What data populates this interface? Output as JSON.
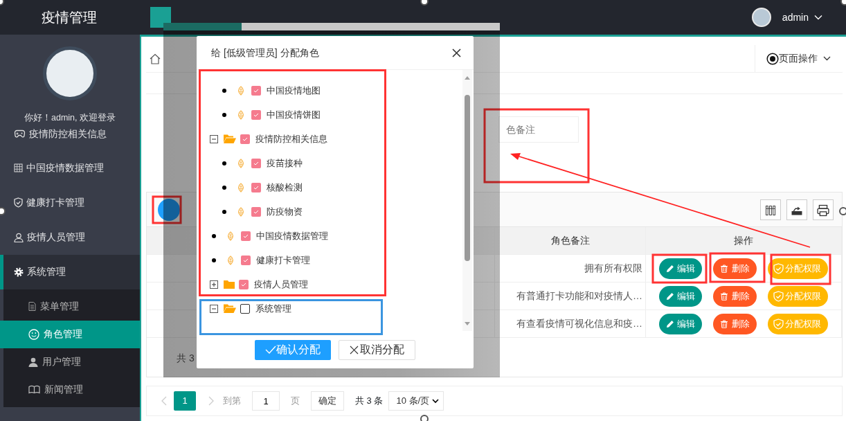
{
  "app": {
    "title": "疫情管理"
  },
  "user": {
    "name": "admin"
  },
  "sidebar": {
    "greeting": "你好！admin, 欢迎登录",
    "items": [
      {
        "label": "疫情防控相关信息",
        "expanded": false
      },
      {
        "label": "中国疫情数据管理",
        "expanded": false
      },
      {
        "label": "健康打卡管理",
        "expanded": false
      },
      {
        "label": "疫情人员管理",
        "expanded": false
      },
      {
        "label": "系统管理",
        "expanded": true,
        "children": [
          {
            "label": "菜单管理",
            "selected": false
          },
          {
            "label": "角色管理",
            "selected": true
          },
          {
            "label": "用户管理",
            "selected": false
          },
          {
            "label": "新闻管理",
            "selected": false
          }
        ]
      }
    ]
  },
  "page_actions": {
    "label": "页面操作"
  },
  "search": {
    "placeholder": "色备注"
  },
  "table": {
    "columns": [
      "角色备注",
      "操作"
    ],
    "rows": [
      {
        "remark": "拥有所有权限",
        "actions": [
          "编辑",
          "删除",
          "分配权限"
        ]
      },
      {
        "remark": "有普通打卡功能和对疫情人…",
        "actions": [
          "编辑",
          "删除",
          "分配权限"
        ]
      },
      {
        "remark": "有查看疫情可视化信息和疫…",
        "actions": [
          "编辑",
          "删除",
          "分配权限"
        ]
      }
    ],
    "footer": "共 3"
  },
  "pagination": {
    "pages": [
      {
        "label": "1",
        "selected": true
      }
    ],
    "goto_label": "到第",
    "page_input": "1",
    "page_unit": "页",
    "confirm": "确定",
    "total": "共 3 条",
    "page_size": "10 条/页"
  },
  "dialog": {
    "title": "给 [低级管理员] 分配角色",
    "tree": [
      {
        "children": [
          {
            "label": "中国疫情地图",
            "checked": true
          },
          {
            "label": "中国疫情饼图",
            "checked": true
          }
        ]
      },
      {
        "label": "疫情防控相关信息",
        "checked": true,
        "expanded": true,
        "children": [
          {
            "label": "疫苗接种",
            "checked": true
          },
          {
            "label": "核酸检测",
            "checked": true
          },
          {
            "label": "防疫物资",
            "checked": true
          }
        ]
      },
      {
        "label": "中国疫情数据管理",
        "checked": true
      },
      {
        "label": "健康打卡管理",
        "checked": true
      },
      {
        "label": "疫情人员管理",
        "checked": true,
        "expanded": false
      },
      {
        "label": "系统管理",
        "checked": false,
        "expanded": true
      }
    ],
    "buttons": [
      "确认分配",
      "取消分配"
    ]
  }
}
